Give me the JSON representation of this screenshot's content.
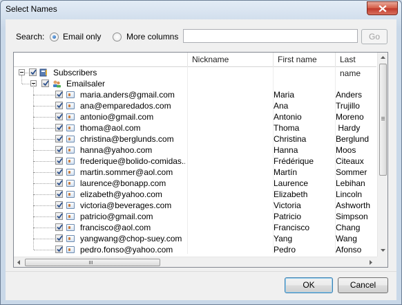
{
  "window": {
    "title": "Select Names"
  },
  "search": {
    "label": "Search:",
    "option_email": "Email only",
    "option_more": "More columns",
    "selected": "email_only",
    "input_value": "",
    "go_label": "Go"
  },
  "columns": {
    "email": "",
    "nickname": "Nickname",
    "first_name": "First name",
    "last_name": "Last name"
  },
  "tree": {
    "root": {
      "label": "Subscribers",
      "checked": true,
      "expanded": true
    },
    "group": {
      "label": "Emailsaler",
      "checked": true,
      "expanded": true
    },
    "contacts": [
      {
        "email": "maria.anders@gmail.com",
        "nickname": "",
        "first": "Maria",
        "last": "Anders",
        "checked": true
      },
      {
        "email": "ana@emparedados.com",
        "nickname": "",
        "first": "Ana",
        "last": "Trujillo",
        "checked": true
      },
      {
        "email": "antonio@gmail.com",
        "nickname": "",
        "first": "Antonio",
        "last": "Moreno",
        "checked": true
      },
      {
        "email": "thoma@aol.com",
        "nickname": "",
        "first": "Thoma",
        "last": " Hardy",
        "checked": true
      },
      {
        "email": "christina@berglunds.com",
        "nickname": "",
        "first": "Christina",
        "last": "Berglund",
        "checked": true
      },
      {
        "email": "hanna@yahoo.com",
        "nickname": "",
        "first": "Hanna",
        "last": "Moos",
        "checked": true
      },
      {
        "email": "frederique@bolido-comidas....",
        "nickname": "",
        "first": "Frédérique",
        "last": "Citeaux",
        "checked": true
      },
      {
        "email": "martin.sommer@aol.com",
        "nickname": "",
        "first": "Martín",
        "last": "Sommer",
        "checked": true
      },
      {
        "email": "laurence@bonapp.com",
        "nickname": "",
        "first": "Laurence",
        "last": "Lebihan",
        "checked": true
      },
      {
        "email": "elizabeth@yahoo.com",
        "nickname": "",
        "first": "Elizabeth",
        "last": "Lincoln",
        "checked": true
      },
      {
        "email": "victoria@beverages.com",
        "nickname": "",
        "first": "Victoria",
        "last": "Ashworth",
        "checked": true
      },
      {
        "email": "patricio@gmail.com",
        "nickname": "",
        "first": "Patricio",
        "last": "Simpson",
        "checked": true
      },
      {
        "email": "francisco@aol.com",
        "nickname": "",
        "first": "Francisco",
        "last": "Chang",
        "checked": true
      },
      {
        "email": "yangwang@chop-suey.com",
        "nickname": "",
        "first": "Yang",
        "last": "Wang",
        "checked": true
      },
      {
        "email": "pedro.fonso@yahoo.com",
        "nickname": "",
        "first": "Pedro",
        "last": "Afonso",
        "checked": true
      }
    ]
  },
  "buttons": {
    "ok": "OK",
    "cancel": "Cancel"
  },
  "icons": {
    "close": "close-icon",
    "contact": "contact-card-icon",
    "group": "group-icon",
    "address_book": "address-book-icon"
  },
  "colors": {
    "titlebar": "#c9d8e8",
    "close_button": "#c0392b",
    "selected_radio": "#1c5aa8"
  }
}
